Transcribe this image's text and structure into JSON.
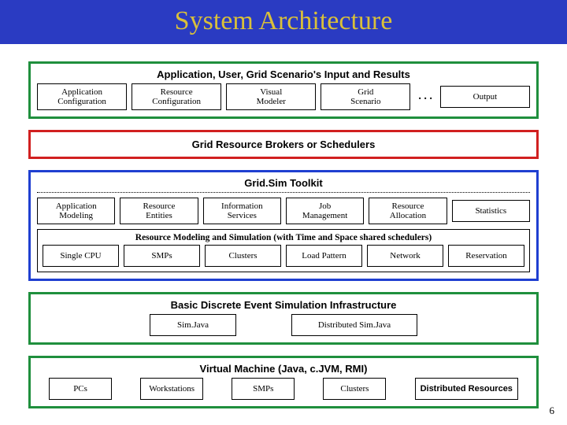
{
  "title": "System Architecture",
  "page_number": "6",
  "ellipsis": ". . .",
  "layers": {
    "top": {
      "title": "Application, User, Grid Scenario's Input and Results",
      "items": [
        "Application\nConfiguration",
        "Resource\nConfiguration",
        "Visual\nModeler",
        "Grid\nScenario",
        "Output"
      ]
    },
    "brokers": {
      "title": "Grid Resource Brokers or Schedulers"
    },
    "toolkit": {
      "title": "Grid.Sim Toolkit",
      "row1": [
        "Application\nModeling",
        "Resource\nEntities",
        "Information\nServices",
        "Job\nManagement",
        "Resource\nAllocation",
        "Statistics"
      ],
      "sub_title": "Resource Modeling and Simulation (with Time and Space shared schedulers)",
      "row2": [
        "Single CPU",
        "SMPs",
        "Clusters",
        "Load Pattern",
        "Network",
        "Reservation"
      ]
    },
    "basic": {
      "title": "Basic Discrete Event Simulation Infrastructure",
      "items": [
        "Sim.Java",
        "Distributed Sim.Java"
      ]
    },
    "vm": {
      "title": "Virtual Machine (Java, c.JVM, RMI)",
      "items": [
        "PCs",
        "Workstations",
        "SMPs",
        "Clusters",
        "Distributed Resources"
      ]
    }
  }
}
